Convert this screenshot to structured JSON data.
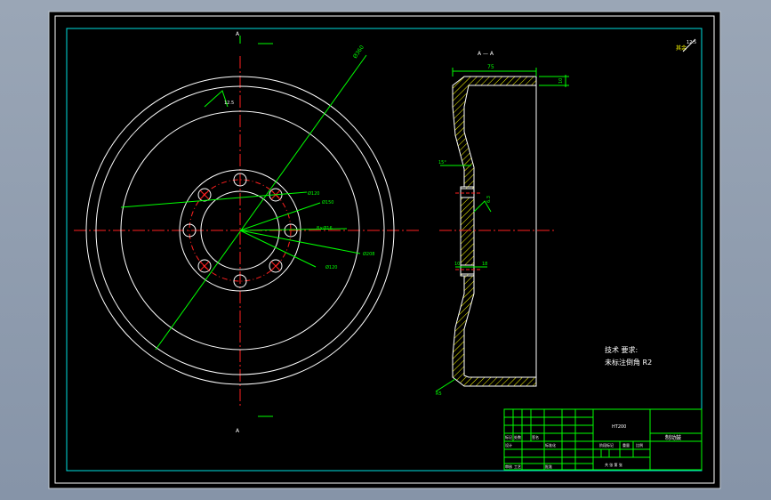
{
  "colors": {
    "background": "#000000",
    "frame": "#ffffff",
    "border": "#00e0e0",
    "geometry": "#ffffff",
    "centerline": "#ff2020",
    "dimension": "#00ff00",
    "hatch": "#ffff00",
    "app_chrome": "#8e9bb0"
  },
  "front_view": {
    "section_marks": [
      "A",
      "A"
    ],
    "roughness": "12.5",
    "dims": {
      "outer": "Ø360",
      "d1": "Ø120",
      "d2": "Ø150",
      "pcd": "8×Ø16",
      "d3": "Ø208",
      "d4": "Ø120"
    }
  },
  "section_view": {
    "title": "A — A",
    "width_dim": "75",
    "top_dim": "10",
    "angle_dim": "15°",
    "small_dim_left": "10",
    "small_dim_right": "18",
    "roughness": "6.3",
    "bottom_dim": "R5"
  },
  "roughness_corner": "12.5",
  "tech_requirements": {
    "title": "技术 要求:",
    "line1": "未标注倒角 R2"
  },
  "title_block": {
    "part_name": "制动鼓",
    "material": "HT200",
    "label_mark": "标记",
    "label_count": "处数",
    "label_sign": "签名",
    "label_design": "设计",
    "label_standard": "标准化",
    "label_stage": "阶段标记",
    "label_weight": "重量",
    "label_ratio": "比例",
    "label_review": "审核",
    "label_process": "工艺",
    "label_approve": "批准",
    "label_sheet": "共 张   第 张"
  }
}
